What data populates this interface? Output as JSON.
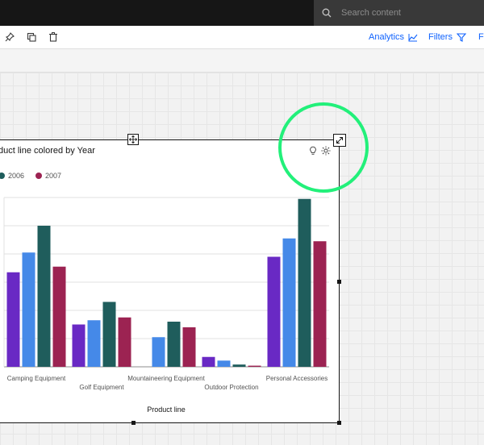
{
  "search": {
    "placeholder": "Search content",
    "icon": "search-icon"
  },
  "toolbar": {
    "icons": [
      "pin-icon",
      "copy-icon",
      "trash-icon"
    ],
    "analytics_label": "Analytics",
    "filters_label": "Filters",
    "third_label": "F"
  },
  "widget": {
    "title": "duct line colored by Year",
    "icons": [
      "lightbulb-icon",
      "settings-icon",
      "expand-icon",
      "move-icon"
    ]
  },
  "colors": {
    "2004": "#6929c4",
    "2005": "#4589e8",
    "2006": "#1f5d5c",
    "2007": "#9c2352",
    "highlight": "#22f07a",
    "accent": "#0f62fe"
  },
  "chart_data": {
    "type": "bar",
    "xlabel": "Product line",
    "ylabel": "",
    "ylim": [
      0,
      6
    ],
    "categories": [
      "Camping Equipment",
      "Golf Equipment",
      "Mountaineering Equipment",
      "Outdoor Protection",
      "Personal Accessories"
    ],
    "series": [
      {
        "name": "",
        "values": [
          3.35,
          1.5,
          0,
          0.35,
          3.9
        ]
      },
      {
        "name": "",
        "values": [
          4.05,
          1.65,
          1.05,
          0.22,
          4.55
        ]
      },
      {
        "name": "2006",
        "values": [
          5.0,
          2.3,
          1.6,
          0.08,
          5.95
        ]
      },
      {
        "name": "2007",
        "values": [
          3.55,
          1.75,
          1.4,
          0.04,
          4.45
        ]
      }
    ],
    "legend_position": "top-left",
    "grid": true
  }
}
